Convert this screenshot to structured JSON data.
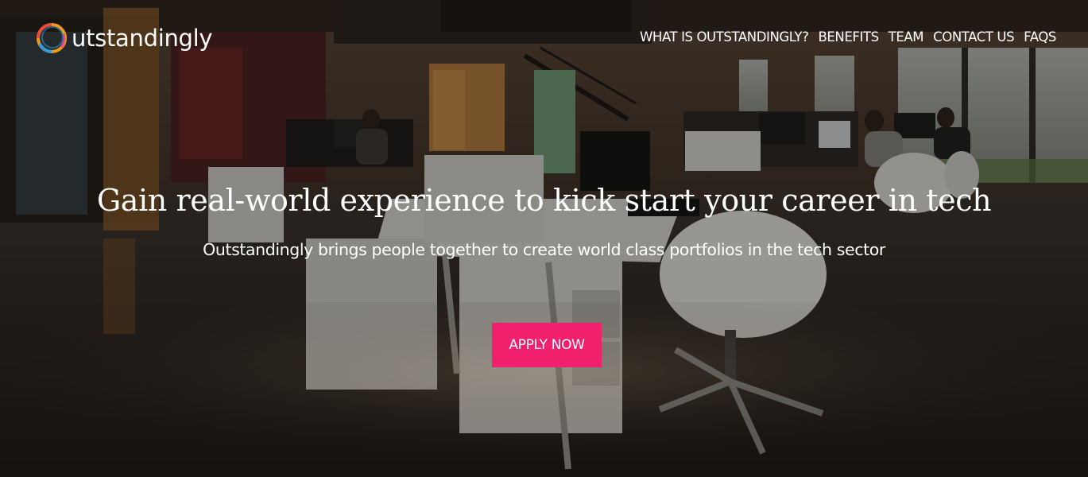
{
  "brand": {
    "name": "utstandingly",
    "logo_icon": "swirl-ring-logo-icon",
    "logo_colors": [
      "#f39c12",
      "#e74c3c",
      "#3498db",
      "#2ecc71"
    ]
  },
  "nav": {
    "items": [
      {
        "label": "WHAT IS OUTSTANDINGLY?"
      },
      {
        "label": "BENEFITS"
      },
      {
        "label": "TEAM"
      },
      {
        "label": "CONTACT US"
      },
      {
        "label": "FAQS"
      }
    ]
  },
  "hero": {
    "headline": "Gain real-world experience to kick start your career in tech",
    "subheadline": "Outstandingly brings people together to create world class portfolios in the tech sector",
    "cta_label": "APPLY NOW",
    "cta_color": "#f0206c",
    "background_image": "dark-open-plan-office-photo"
  }
}
